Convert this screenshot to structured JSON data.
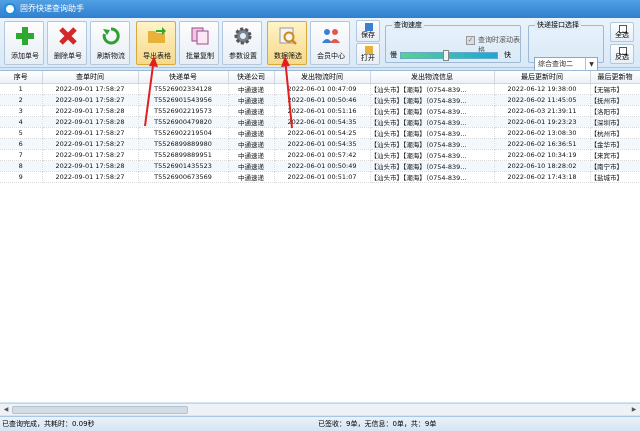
{
  "window": {
    "title": "固乔快递查询助手"
  },
  "toolbar": {
    "buttons": [
      {
        "label": "添加单号",
        "icon": "plus-icon"
      },
      {
        "label": "删除单号",
        "icon": "x-icon"
      },
      {
        "label": "刷新物流",
        "icon": "refresh-icon"
      },
      {
        "label": "导出表格",
        "icon": "export-folder-icon"
      },
      {
        "label": "批量复制",
        "icon": "copy-icon"
      },
      {
        "label": "参数设置",
        "icon": "gear-icon"
      },
      {
        "label": "数据筛选",
        "icon": "filter-icon"
      },
      {
        "label": "会员中心",
        "icon": "members-icon"
      }
    ],
    "save_label": "保存",
    "open_label": "打开",
    "speed": {
      "group_label": "查询速度",
      "slow_label": "慢",
      "fast_label": "快",
      "scroll_label": "查询时滚动表格",
      "level": 0.47
    },
    "api": {
      "group_label": "快递接口选择",
      "selected": "综合查询二"
    },
    "select_all_label": "全选",
    "invert_label": "反选"
  },
  "table": {
    "columns": [
      "序号",
      "查单时间",
      "快递单号",
      "快递公司",
      "发出物流时间",
      "发出物流信息",
      "最后更新时间",
      "最后更新物"
    ],
    "rows": [
      [
        "1",
        "2022-09-01 17:58:27",
        "T5526902334128",
        "中通速递",
        "2022-06-01 00:47:09",
        "【汕头市】【潮海】（0754-839...",
        "2022-06-12 19:38:00",
        "【无锡市】"
      ],
      [
        "2",
        "2022-09-01 17:58:27",
        "T5526901543956",
        "中通速递",
        "2022-06-01 00:50:46",
        "【汕头市】【潮海】（0754-839...",
        "2022-06-02 11:45:05",
        "【抚州市】"
      ],
      [
        "3",
        "2022-09-01 17:58:28",
        "T5526902219573",
        "中通速递",
        "2022-06-01 00:51:16",
        "【汕头市】【潮海】（0754-839...",
        "2022-06-03 21:39:11",
        "【洛阳市】"
      ],
      [
        "4",
        "2022-09-01 17:58:28",
        "T5526900479820",
        "中通速递",
        "2022-06-01 00:54:35",
        "【汕头市】【潮海】（0754-839...",
        "2022-06-01 19:23:23",
        "【深圳市】"
      ],
      [
        "5",
        "2022-09-01 17:58:27",
        "T5526902219504",
        "中通速递",
        "2022-06-01 00:54:25",
        "【汕头市】【潮海】（0754-839...",
        "2022-06-02 13:08:30",
        "【杭州市】"
      ],
      [
        "6",
        "2022-09-01 17:58:27",
        "T5526899889980",
        "中通速递",
        "2022-06-01 00:54:35",
        "【汕头市】【潮海】（0754-839...",
        "2022-06-02 16:36:51",
        "【金华市】"
      ],
      [
        "7",
        "2022-09-01 17:58:27",
        "T5526899889951",
        "中通速递",
        "2022-06-01 00:57:42",
        "【汕头市】【潮海】（0754-839...",
        "2022-06-02 10:34:19",
        "【来宾市】"
      ],
      [
        "8",
        "2022-09-01 17:58:28",
        "T5526901435523",
        "中通速递",
        "2022-06-01 00:50:49",
        "【汕头市】【潮海】（0754-839...",
        "2022-06-10 18:28:02",
        "【南宁市】"
      ],
      [
        "9",
        "2022-09-01 17:58:27",
        "T5526900673569",
        "中通速递",
        "2022-06-01 00:51:07",
        "【汕头市】【潮海】（0754-839...",
        "2022-06-02 17:43:18",
        "【盐城市】"
      ]
    ]
  },
  "status": {
    "left": "已查询完成，共耗时：0.09秒",
    "right": "已签收：9单，无信息：0单，共：9单"
  },
  "colors": {
    "accent": "#2f7fcf",
    "toolbar_bg": "#e0edf9",
    "active_button": "#f6d98a",
    "arrow_red": "#e02020"
  }
}
